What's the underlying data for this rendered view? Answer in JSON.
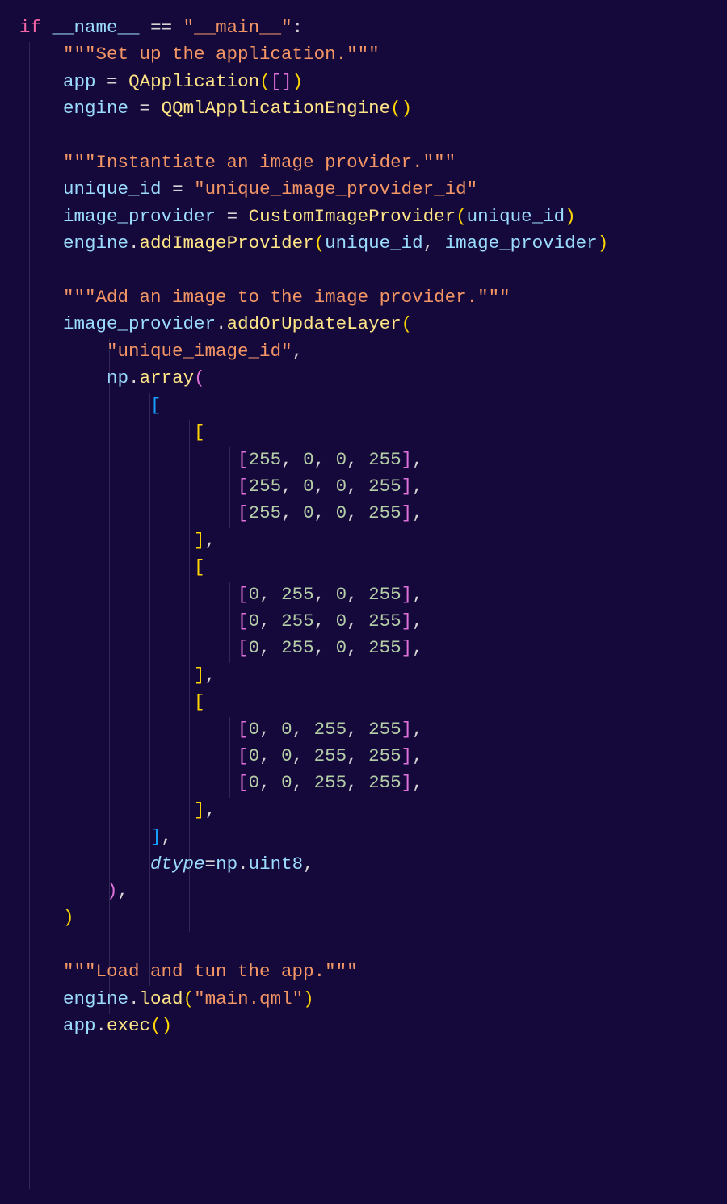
{
  "code": {
    "if_kw": "if",
    "name_dunder": "__name__",
    "eq_op": "==",
    "main_str": "\"__main__\"",
    "colon": ":",
    "doc1": "\"\"\"Set up the application.\"\"\"",
    "app_var": "app",
    "assign": "=",
    "QApplication": "QApplication",
    "engine_var": "engine",
    "QQmlApplicationEngine": "QQmlApplicationEngine",
    "doc2": "\"\"\"Instantiate an image provider.\"\"\"",
    "unique_id_var": "unique_id",
    "unique_id_str": "\"unique_image_provider_id\"",
    "image_provider_var": "image_provider",
    "CustomImageProvider": "CustomImageProvider",
    "addImageProvider": "addImageProvider",
    "doc3": "\"\"\"Add an image to the image provider.\"\"\"",
    "addOrUpdateLayer": "addOrUpdateLayer",
    "unique_image_id_str": "\"unique_image_id\"",
    "np_var": "np",
    "array_fn": "array",
    "n255": "255",
    "n0": "0",
    "dtype_kw": "dtype",
    "uint8": "uint8",
    "doc4": "\"\"\"Load and tun the app.\"\"\"",
    "load_fn": "load",
    "main_qml_str": "\"main.qml\"",
    "exec_fn": "exec"
  }
}
